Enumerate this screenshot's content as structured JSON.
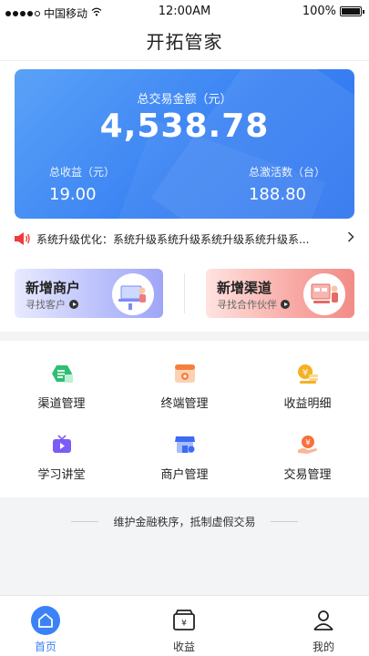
{
  "status_bar": {
    "carrier": "中国移动",
    "time": "12:00AM",
    "battery": "100%"
  },
  "nav": {
    "title": "开拓管家"
  },
  "stats": {
    "total_label": "总交易金额（元）",
    "total_value": "4,538.78",
    "income_label": "总收益（元）",
    "income_value": "19.00",
    "activation_label": "总激活数（台）",
    "activation_value": "188.80"
  },
  "notice": {
    "text": "系统升级优化：系统升级系统升级系统升级系统升级系..."
  },
  "promos": [
    {
      "title": "新增商户",
      "subtitle": "寻找客户"
    },
    {
      "title": "新增渠道",
      "subtitle": "寻找合作伙伴"
    }
  ],
  "grid": [
    {
      "label": "渠道管理",
      "icon": "channel-icon",
      "color": "#2fbf71"
    },
    {
      "label": "终端管理",
      "icon": "terminal-icon",
      "color": "#f5803e"
    },
    {
      "label": "收益明细",
      "icon": "income-icon",
      "color": "#f6b023"
    },
    {
      "label": "学习讲堂",
      "icon": "tv-icon",
      "color": "#7c5cf6"
    },
    {
      "label": "商户管理",
      "icon": "store-icon",
      "color": "#3b6cf6"
    },
    {
      "label": "交易管理",
      "icon": "trade-icon",
      "color": "#f5703e"
    }
  ],
  "slogan": "维护金融秩序，抵制虚假交易",
  "tabbar": [
    {
      "label": "首页",
      "icon": "home-icon"
    },
    {
      "label": "收益",
      "icon": "income-tab-icon"
    },
    {
      "label": "我的",
      "icon": "profile-icon"
    }
  ],
  "colors": {
    "primary": "#3b82f6",
    "card_gradient_start": "#5aa2f7",
    "card_gradient_end": "#2f75ee"
  }
}
